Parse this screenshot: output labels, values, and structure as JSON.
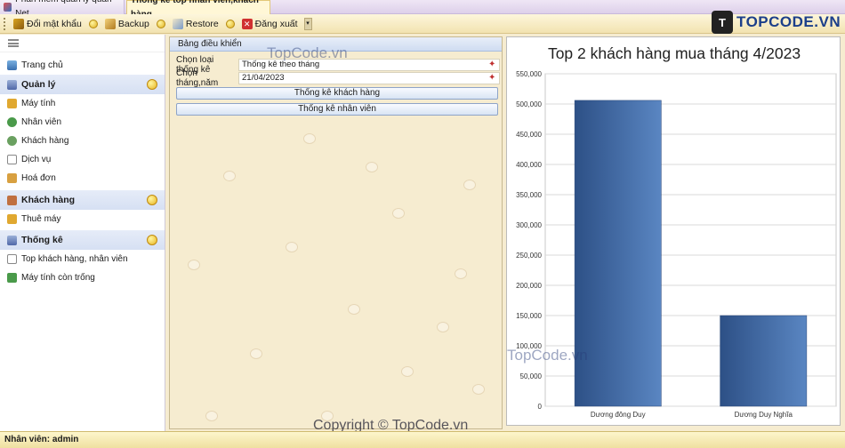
{
  "tabs": [
    {
      "label": "Phần mềm quản lý quán Net"
    },
    {
      "label": "Thống kê top nhân viên,khách hàng"
    }
  ],
  "toolbar": {
    "items": [
      {
        "label": "Đổi mật khẩu",
        "icon": "key-icon"
      },
      {
        "label": "Backup",
        "icon": "backup-icon"
      },
      {
        "label": "Restore",
        "icon": "restore-icon"
      },
      {
        "label": "Đăng xuất",
        "icon": "logout-icon"
      }
    ]
  },
  "logo": {
    "mark": "T",
    "text": "TOPCODE.VN"
  },
  "sidebar": {
    "home": "Trang chủ",
    "groups": [
      {
        "label": "Quản lý",
        "items": [
          "Máy tính",
          "Nhân viên",
          "Khách hàng",
          "Dịch vụ",
          "Hoá đơn"
        ]
      },
      {
        "label": "Khách hàng",
        "items": [
          "Thuê máy"
        ]
      },
      {
        "label": "Thống kê",
        "items": [
          "Top khách hàng, nhân viên",
          "Máy tính còn trống"
        ]
      }
    ]
  },
  "panel": {
    "title": "Bảng điều khiển",
    "type_label": "Chọn loại thống kê",
    "type_value": "Thống kê theo tháng",
    "month_label": "Chọn tháng,năm",
    "month_value": "21/04/2023",
    "btn_customers": "Thống kê khách hàng",
    "btn_staff": "Thống kê nhân viên"
  },
  "chart_data": {
    "type": "bar",
    "title": "Top 2 khách hàng mua tháng 4/2023",
    "categories": [
      "Dương đông Duy",
      "Dương Duy Nghĩa"
    ],
    "values": [
      506000,
      150000
    ],
    "ylim": [
      0,
      550000
    ],
    "yticks": [
      0,
      50000,
      100000,
      150000,
      200000,
      250000,
      300000,
      350000,
      400000,
      450000,
      500000,
      550000
    ],
    "ytick_labels": [
      "0",
      "50,000",
      "100,000",
      "150,000",
      "200,000",
      "250,000",
      "300,000",
      "350,000",
      "400,000",
      "450,000",
      "500,000",
      "550,000"
    ],
    "grid": true,
    "bar_color": "#4a74ad"
  },
  "status": {
    "label": "Nhân viên:",
    "user": "admin"
  },
  "watermarks": [
    "TopCode.vn",
    "TopCode.vn",
    "Copyright © TopCode.vn"
  ]
}
